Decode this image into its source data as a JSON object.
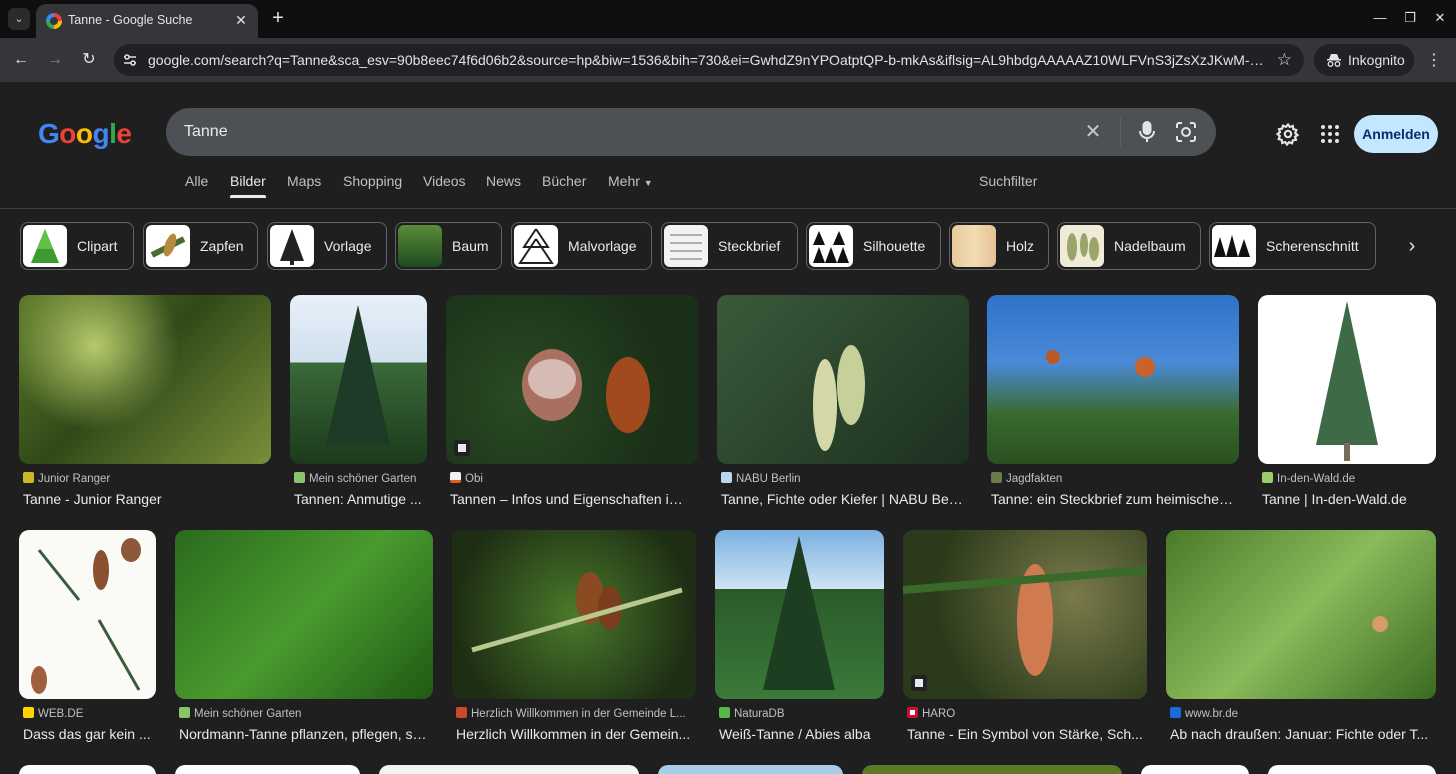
{
  "browser": {
    "tab_title": "Tanne - Google Suche",
    "url": "google.com/search?q=Tanne&sca_esv=90b8eec74f6d06b2&source=hp&biw=1536&bih=730&ei=GwhdZ9nYPOatptQP-b-mkAs&iflsig=AL9hbdgAAAAAZ10WLFVnS3jZsXzJKwM-n94m2dhQs...",
    "incognito_label": "Inkognito"
  },
  "header": {
    "logo": "Google",
    "query": "Tanne",
    "signin_label": "Anmelden"
  },
  "nav": {
    "tabs": [
      "Alle",
      "Bilder",
      "Maps",
      "Shopping",
      "Videos",
      "News",
      "Bücher",
      "Mehr"
    ],
    "active": "Bilder",
    "filter_label": "Suchfilter"
  },
  "chips": [
    "Clipart",
    "Zapfen",
    "Vorlage",
    "Baum",
    "Malvorlage",
    "Steckbrief",
    "Silhouette",
    "Holz",
    "Nadelbaum",
    "Scherenschnitt"
  ],
  "results": [
    {
      "source": "Junior Ranger",
      "title": "Tanne - Junior Ranger"
    },
    {
      "source": "Mein schöner Garten",
      "title": "Tannen: Anmutige ..."
    },
    {
      "source": "Obi",
      "title": "Tannen – Infos und Eigenschaften im ..."
    },
    {
      "source": "NABU Berlin",
      "title": "Tanne, Fichte oder Kiefer | NABU Berlin"
    },
    {
      "source": "Jagdfakten",
      "title": "Tanne: ein Steckbrief zum heimischen..."
    },
    {
      "source": "In-den-Wald.de",
      "title": "Tanne | In-den-Wald.de"
    },
    {
      "source": "WEB.DE",
      "title": "Dass das gar kein ..."
    },
    {
      "source": "Mein schöner Garten",
      "title": "Nordmann-Tanne pflanzen, pflegen, sc..."
    },
    {
      "source": "Herzlich Willkommen in der Gemeinde L...",
      "title": "Herzlich Willkommen in der Gemein..."
    },
    {
      "source": "NaturaDB",
      "title": "Weiß-Tanne / Abies alba"
    },
    {
      "source": "HARO",
      "title": "Tanne - Ein Symbol von Stärke, Sch..."
    },
    {
      "source": "www.br.de",
      "title": "Ab nach draußen: Januar: Fichte oder T..."
    }
  ]
}
